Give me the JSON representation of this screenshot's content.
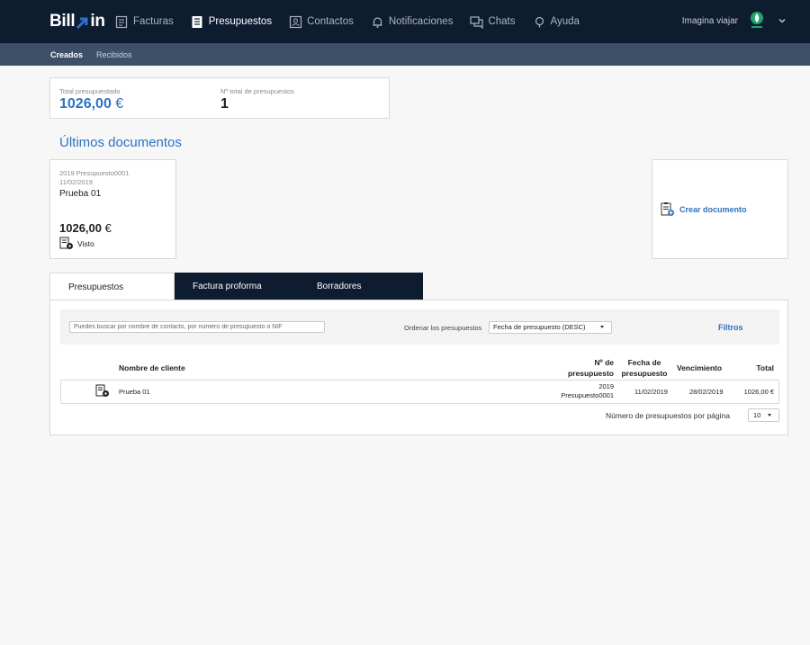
{
  "topbar": {
    "logo_left": "Bill",
    "logo_right": "in",
    "nav": [
      {
        "label": "Facturas",
        "icon": "invoices-icon",
        "active": false
      },
      {
        "label": "Presupuestos",
        "icon": "budgets-icon",
        "active": true
      },
      {
        "label": "Contactos",
        "icon": "contacts-icon",
        "active": false
      },
      {
        "label": "Notificaciones",
        "icon": "bell-icon",
        "active": false
      },
      {
        "label": "Chats",
        "icon": "chat-icon",
        "active": false
      },
      {
        "label": "Ayuda",
        "icon": "help-icon",
        "active": false
      }
    ],
    "account_name": "Imagina viajar"
  },
  "subnav": [
    {
      "label": "Creados",
      "active": true
    },
    {
      "label": "Recibidos",
      "active": false
    }
  ],
  "stats": {
    "total_label": "Total presupuestado",
    "total_value": "1026,00",
    "total_currency": "€",
    "count_label": "Nº total de presupuestos",
    "count_value": "1"
  },
  "recent": {
    "title": "Últimos documentos",
    "card": {
      "ref": "2019 Presupuesto0001",
      "date": "11/02/2019",
      "name": "Prueba 01",
      "amount": "1026,00",
      "currency": "€",
      "status": "Visto"
    },
    "create_label": "Crear documento"
  },
  "tabs": [
    {
      "label": "Presupuestos",
      "active": true
    },
    {
      "label": "Factura proforma",
      "active": false
    },
    {
      "label": "Borradores",
      "active": false
    }
  ],
  "filters": {
    "search_placeholder": "Puedes buscar por nombre de contacto, por número de presupuesto o NIF",
    "order_label": "Ordenar los presupuestos",
    "order_value": "Fecha de presupuesto (DESC)",
    "filters_label": "Filtros"
  },
  "table": {
    "headers": {
      "client": "Nombre de cliente",
      "number_1": "Nº de",
      "number_2": "presupuesto",
      "date_1": "Fecha de",
      "date_2": "presupuesto",
      "due": "Vencimiento",
      "total": "Total"
    },
    "rows": [
      {
        "client": "Prueba 01",
        "number_1": "2019",
        "number_2": "Presupuesto0001",
        "date": "11/02/2019",
        "due": "28/02/2019",
        "total": "1026,00 €"
      }
    ]
  },
  "pagination": {
    "label": "Número de presupuestos por página",
    "value": "10"
  },
  "colors": {
    "navy": "#0e1c30",
    "subbar": "#3d5068",
    "accent": "#2c72c6",
    "brand_green": "#1fa36a"
  }
}
